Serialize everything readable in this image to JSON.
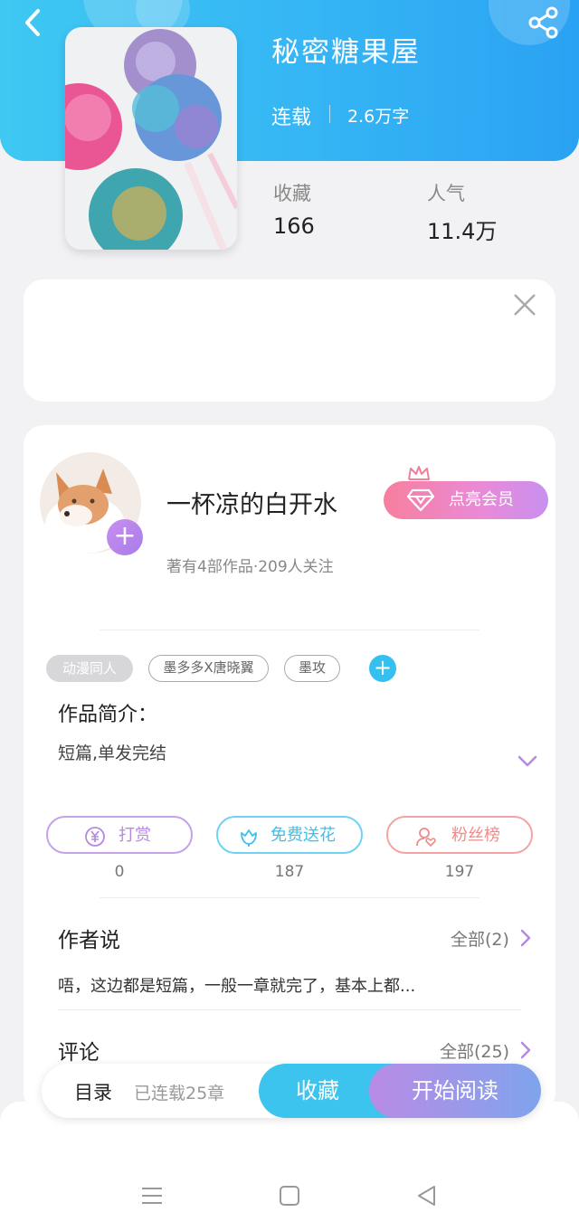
{
  "header": {
    "title": "秘密糖果屋",
    "status": "连载",
    "word_count": "2.6万字",
    "stats": [
      {
        "label": "收藏",
        "value": "166"
      },
      {
        "label": "人气",
        "value": "11.4万"
      }
    ],
    "colors": {
      "gradient_start": "#3ec8f2",
      "gradient_end": "#2aa2f3"
    }
  },
  "icons": {
    "back": "chevron-left-icon",
    "share": "share-icon",
    "close": "close-icon",
    "crown": "crown-icon",
    "diamond": "diamond-icon",
    "yen": "yen-icon",
    "flower": "flower-icon",
    "fans": "user-heart-icon"
  },
  "author": {
    "name": "一杯凉的白开水",
    "meta": "著有4部作品·209人关注",
    "vip_label": "点亮会员",
    "follow_plus": "+"
  },
  "tags": [
    "动漫同人",
    "墨多多X唐晓翼",
    "墨攻"
  ],
  "tag_add": "+",
  "intro": {
    "title": "作品简介：",
    "text": "短篇,单发完结"
  },
  "actions": [
    {
      "label": "打赏",
      "count": "0",
      "color": "#b48be0"
    },
    {
      "label": "免费送花",
      "count": "187",
      "color": "#3cc0ea"
    },
    {
      "label": "粉丝榜",
      "count": "197",
      "color": "#f08a8a"
    }
  ],
  "author_says": {
    "title": "作者说",
    "more": "全部(2)",
    "text": "唔，这边都是短篇，一般一章就完了，基本上都..."
  },
  "comments": {
    "title": "评论",
    "more": "全部(25)"
  },
  "bottom_bar": {
    "toc": "目录",
    "status": "已连载25章",
    "favorite": "收藏",
    "read": "开始阅读"
  }
}
